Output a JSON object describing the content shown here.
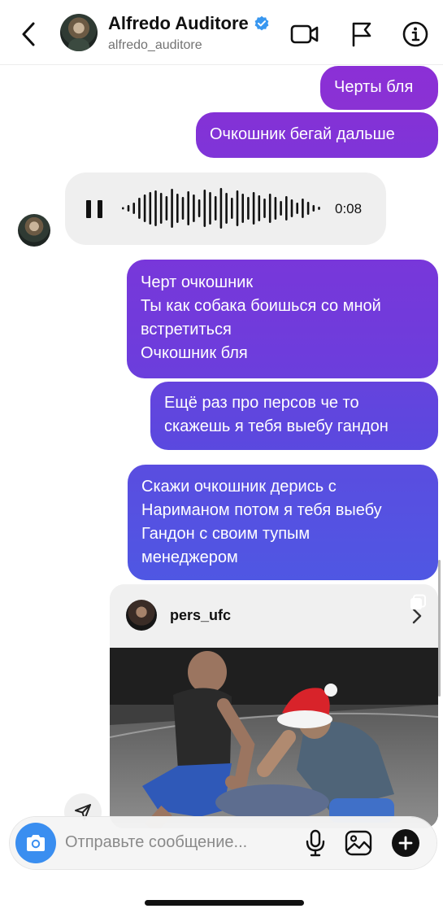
{
  "header": {
    "name": "Alfredo Auditore",
    "username": "alfredo_auditore"
  },
  "messages": {
    "m1": [
      "Черты бля"
    ],
    "m2": [
      "Очкошник бегай дальше"
    ],
    "voice_time": "0:08",
    "m3": [
      "Черт очкошник",
      "Ты как собака боишься со мной",
      "встретиться",
      "Очкошник бля"
    ],
    "m4": [
      "Ещё раз про персов че то",
      "скажешь я тебя выебу гандон"
    ],
    "m5": [
      "Скажи очкошник дерись с",
      "Нариманом потом я тебя выебу",
      "Гандон с своим тупым",
      "менеджером"
    ]
  },
  "shared_post": {
    "username": "pers_ufc"
  },
  "composer": {
    "placeholder": "Отправьте сообщение..."
  },
  "colors": {
    "accent_blue": "#3a8ef0",
    "bubble_purple": "#8a32d4",
    "bubble_indigo": "#4f57e3",
    "verified_blue": "#3897f0"
  },
  "icons": [
    "back-chevron-icon",
    "verified-badge-icon",
    "video-call-icon",
    "flag-icon",
    "info-icon",
    "pause-icon",
    "chevron-right-icon",
    "carousel-icon",
    "share-icon",
    "camera-icon",
    "microphone-icon",
    "gallery-icon",
    "plus-icon"
  ]
}
